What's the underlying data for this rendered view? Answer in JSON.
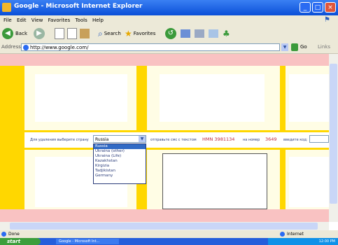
{
  "window": {
    "title": "Google - Microsoft Internet Explorer"
  },
  "menu": {
    "items": [
      "File",
      "Edit",
      "View",
      "Favorites",
      "Tools",
      "Help"
    ]
  },
  "toolbar": {
    "back_label": "Back",
    "search_label": "Search",
    "favorites_label": "Favorites"
  },
  "address": {
    "label": "Address",
    "value": "http://www.google.com/",
    "go_label": "Go",
    "links_label": "Links"
  },
  "form": {
    "country_label": "Для удаления выберите страну",
    "country_selected": "Russia",
    "country_options": [
      "Russia",
      "Ukraina (other)",
      "Ukraina (Life)",
      "Kazakhstan",
      "Kirgizia",
      "Tadjikistan",
      "Germany"
    ],
    "send_label": "отправьте смс с текстом",
    "sms_code": "HMN 3981134",
    "number_label": "на номер",
    "number": "3649",
    "code_label": "введите код:"
  },
  "status": {
    "left": "Done",
    "zone": "Internet"
  },
  "taskbar": {
    "start_label": "start",
    "task_label": "Google - Microsoft Int...",
    "clock": "12:00 PM"
  }
}
